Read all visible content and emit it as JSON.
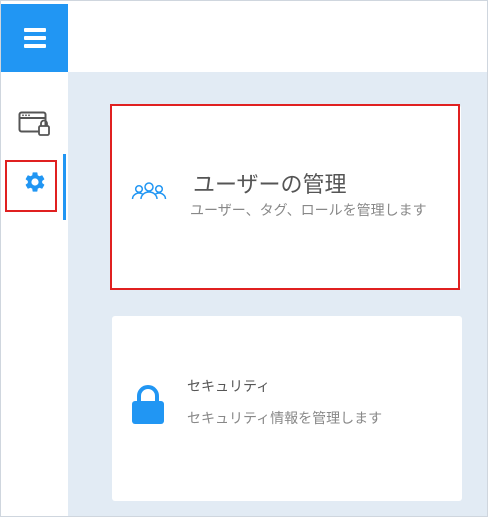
{
  "topbar": {
    "menu_icon": "hamburger-icon"
  },
  "sidebar": {
    "items": [
      {
        "icon": "window-lock-icon"
      },
      {
        "icon": "gear-icon",
        "active": true
      }
    ]
  },
  "cards": [
    {
      "icon": "users-icon",
      "title": "ユーザーの管理",
      "subtitle": "ユーザー、タグ、ロールを管理します"
    },
    {
      "icon": "lock-icon",
      "title": "セキュリティ",
      "subtitle": "セキュリティ情報を管理します"
    }
  ],
  "colors": {
    "accent": "#2196f3",
    "highlight": "#e02020",
    "background": "#e2ebf4"
  }
}
